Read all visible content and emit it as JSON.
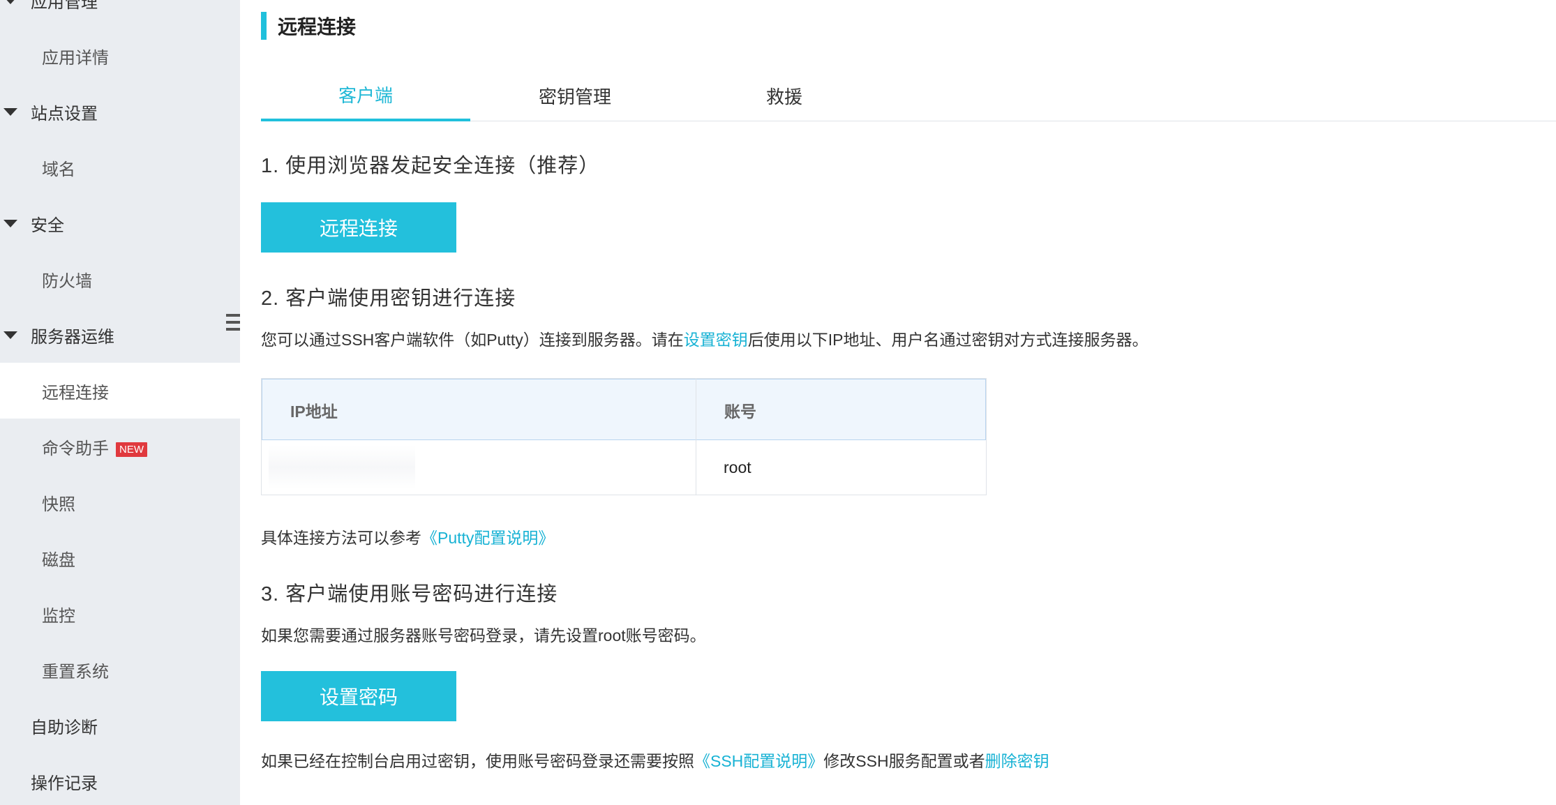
{
  "sidebar": {
    "groups": [
      {
        "label": "应用管理",
        "items": [
          "应用详情"
        ]
      },
      {
        "label": "站点设置",
        "items": [
          "域名"
        ]
      },
      {
        "label": "安全",
        "items": [
          "防火墙"
        ]
      },
      {
        "label": "服务器运维",
        "items": [
          "远程连接",
          "命令助手",
          "快照",
          "磁盘",
          "监控",
          "重置系统"
        ]
      }
    ],
    "active_item": "远程连接",
    "new_badge": "NEW",
    "top_items": [
      "自助诊断",
      "操作记录"
    ]
  },
  "main": {
    "title": "远程连接",
    "tabs": [
      "客户端",
      "密钥管理",
      "救援"
    ],
    "active_tab": "客户端",
    "step1": {
      "heading": "1. 使用浏览器发起安全连接（推荐）",
      "button": "远程连接"
    },
    "step2": {
      "heading": "2. 客户端使用密钥进行连接",
      "desc_before": "您可以通过SSH客户端软件（如Putty）连接到服务器。请在",
      "desc_link": "设置密钥",
      "desc_after": "后使用以下IP地址、用户名通过密钥对方式连接服务器。",
      "table": {
        "headers": [
          "IP地址",
          "账号"
        ],
        "rows": [
          [
            "",
            "root"
          ]
        ]
      },
      "ref_before": "具体连接方法可以参考",
      "ref_link": "《Putty配置说明》"
    },
    "step3": {
      "heading": "3. 客户端使用账号密码进行连接",
      "desc": "如果您需要通过服务器账号密码登录，请先设置root账号密码。",
      "button": "设置密码",
      "note_before": "如果已经在控制台启用过密钥，使用账号密码登录还需要按照",
      "note_link1": "《SSH配置说明》",
      "note_middle": "修改SSH服务配置或者",
      "note_link2": "删除密钥"
    }
  },
  "colors": {
    "accent": "#20c0dc",
    "link": "#17b2d4",
    "sidebar_bg": "#eaedf1",
    "badge": "#e0393e"
  }
}
